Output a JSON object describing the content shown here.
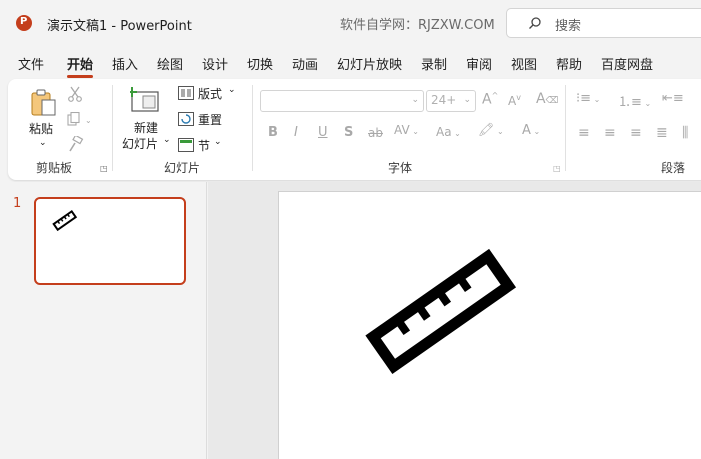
{
  "title_bar": {
    "doc_title": "演示文稿1  -  PowerPoint",
    "site_label": "软件自学网：RJZXW.COM",
    "search_placeholder": "搜索"
  },
  "tabs": [
    "文件",
    "开始",
    "插入",
    "绘图",
    "设计",
    "切换",
    "动画",
    "幻灯片放映",
    "录制",
    "审阅",
    "视图",
    "帮助",
    "百度网盘"
  ],
  "active_tab": "开始",
  "ribbon": {
    "clipboard": {
      "paste_label": "粘贴",
      "group_label": "剪贴板"
    },
    "slides": {
      "new_slide_label_1": "新建",
      "new_slide_label_2": "幻灯片",
      "layout_label": "版式",
      "reset_label": "重置",
      "section_label": "节",
      "group_label": "幻灯片"
    },
    "font": {
      "font_size_value": "24+",
      "group_label": "字体"
    },
    "paragraph": {
      "group_label": "段落"
    }
  },
  "slides_pane": {
    "slide_number": "1"
  },
  "colors": {
    "accent": "#c43e1c",
    "ribbon_bg": "#ffffff",
    "app_bg": "#f3f3f3"
  },
  "icons": {
    "slide_content": "ruler-icon"
  }
}
